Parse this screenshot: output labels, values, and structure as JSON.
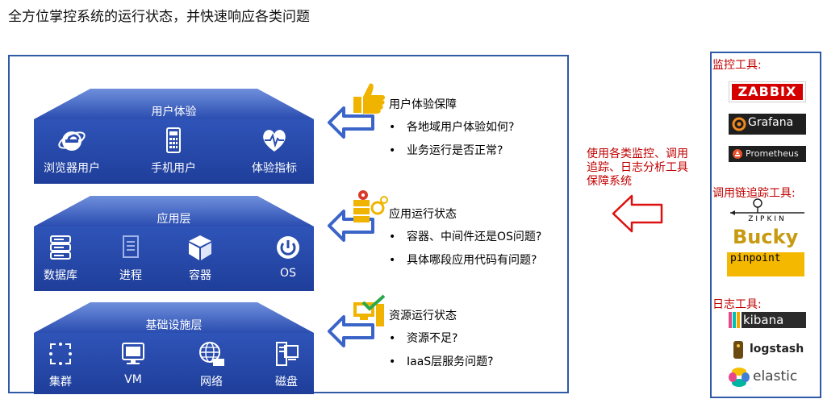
{
  "headline": "全方位掌控系统的运行状态，并快速响应各类问题",
  "layers": [
    {
      "title": "用户体验",
      "items": [
        "浏览器用户",
        "手机用户",
        "体验指标"
      ]
    },
    {
      "title": "应用层",
      "items": [
        "数据库",
        "进程",
        "容器",
        "OS"
      ]
    },
    {
      "title": "基础设施层",
      "items": [
        "集群",
        "VM",
        "网络",
        "磁盘"
      ]
    }
  ],
  "features": [
    {
      "title": "用户体验保障",
      "bullets": [
        "各地域用户体验如何?",
        "业务运行是否正常?"
      ]
    },
    {
      "title": "应用运行状态",
      "bullets": [
        "容器、中间件还是OS问题?",
        "具体哪段应用代码有问题?"
      ]
    },
    {
      "title": "资源运行状态",
      "bullets": [
        "资源不足?",
        "IaaS层服务问题?"
      ]
    }
  ],
  "bullet_char": "•",
  "side_note": [
    "使用各类监控、调用",
    "追踪、日志分析工具",
    "保障系统"
  ],
  "tools": {
    "monitoring_label": "监控工具:",
    "tracing_label": "调用链追踪工具:",
    "logging_label": "日志工具:",
    "zabbix": "ZABBIX",
    "grafana": "Grafana",
    "prometheus": "Prometheus",
    "zipkin": "ZIPKIN",
    "bucky": "Bucky",
    "pinpoint": "pinpoint",
    "kibana": "kibana",
    "logstash": "logstash",
    "elastic": "elastic"
  },
  "colors": {
    "frame": "#2e5aa6",
    "layer": "#2a4db0",
    "note": "#c00000",
    "arrow_blue": "#3a64c8",
    "icon_gold": "#f0b400"
  }
}
